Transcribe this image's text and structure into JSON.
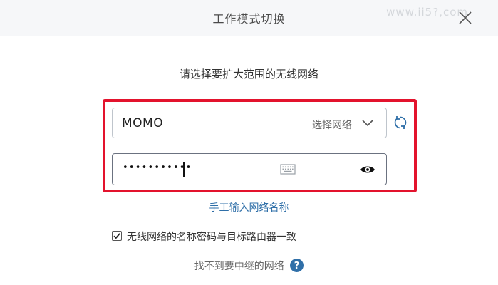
{
  "dialog": {
    "title": "工作模式切换",
    "watermark": "www.ii5?,com",
    "subtitle": "请选择要扩大范围的无线网络"
  },
  "network": {
    "ssid": "MOMO",
    "select_label": "选择网络",
    "password_mask": "•••••••••••",
    "manual_entry_link": "手工输入网络名称",
    "same_credentials_label": "无线网络的名称密码与目标路由器一致",
    "same_credentials_checked": true,
    "not_found_label": "找不到要中继的网络"
  },
  "icons": {
    "close": "close-icon",
    "dropdown": "chevron-down-icon",
    "refresh": "refresh-icon",
    "keyboard": "keyboard-icon",
    "show_password": "eye-icon",
    "checkbox": "checkmark-icon",
    "help": "help-icon"
  },
  "colors": {
    "highlight_border": "#e3132d",
    "link": "#2f6fa8",
    "help_icon_bg": "#2f6fa8",
    "header_bg": "#f6f7f9"
  }
}
